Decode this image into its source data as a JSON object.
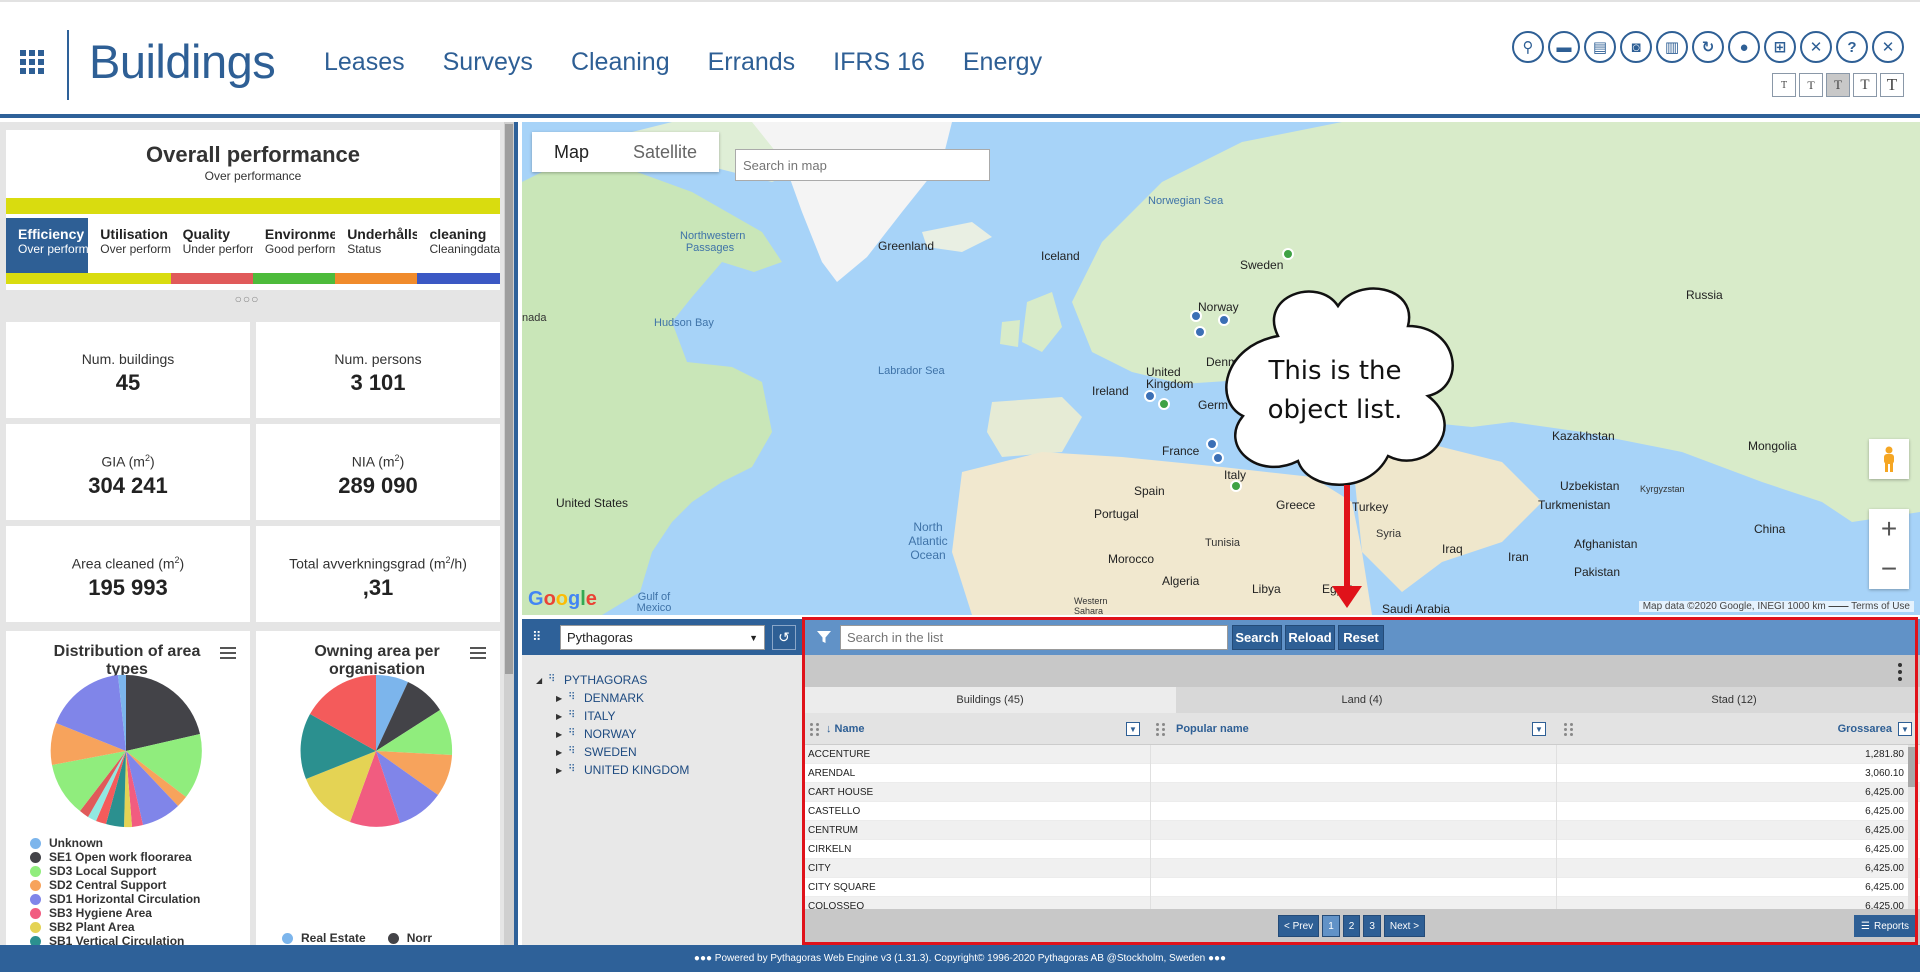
{
  "header": {
    "title": "Buildings",
    "nav": [
      "Leases",
      "Surveys",
      "Cleaning",
      "Errands",
      "IFRS 16",
      "Energy"
    ],
    "text_sizes": [
      "T",
      "T",
      "T",
      "T",
      "T"
    ]
  },
  "performance": {
    "title": "Overall performance",
    "subtitle": "Over performance",
    "dots": "○○○",
    "tabs": [
      {
        "title": "Efficiency",
        "sub": "Over performa",
        "color": "#d9dc0f"
      },
      {
        "title": "Utilisation",
        "sub": "Over performa",
        "color": "#d9dc0f"
      },
      {
        "title": "Quality",
        "sub": "Under perform",
        "color": "#e05a5a"
      },
      {
        "title": "Environme",
        "sub": "Good perform",
        "color": "#4dbb3b"
      },
      {
        "title": "Underhålls",
        "sub": "Status",
        "color": "#f08b2c"
      },
      {
        "title": "cleaning",
        "sub": "Cleaningdata",
        "color": "#3b58c4"
      }
    ]
  },
  "kpis": [
    {
      "label": "Num. buildings",
      "value": "45"
    },
    {
      "label": "Num. persons",
      "value": "3 101"
    },
    {
      "label_pre": "GIA (m",
      "label_sup": "2",
      "label_post": ")",
      "value": "304 241"
    },
    {
      "label_pre": "NIA (m",
      "label_sup": "2",
      "label_post": ")",
      "value": "289 090"
    },
    {
      "label_pre": "Area cleaned (m",
      "label_sup": "2",
      "label_post": ")",
      "value": "195 993"
    },
    {
      "label_pre": "Total avverkningsgrad (m",
      "label_sup": "2",
      "label_post": "/h)",
      "value": ",31"
    }
  ],
  "pies": {
    "area_types": {
      "title": "Distribution of area types",
      "legend": [
        {
          "name": "Unknown",
          "color": "#7cb5ec"
        },
        {
          "name": "SE1 Open work floorarea",
          "color": "#434348"
        },
        {
          "name": "SD3 Local Support",
          "color": "#90ed7d"
        },
        {
          "name": "SD2 Central Support",
          "color": "#f7a35c"
        },
        {
          "name": "SD1 Horizontal Circulation",
          "color": "#8085e9"
        },
        {
          "name": "SB3 Hygiene Area",
          "color": "#f15c80"
        },
        {
          "name": "SB2 Plant Area",
          "color": "#e4d354"
        },
        {
          "name": "SB1 Vertical Circulation",
          "color": "#2b908f"
        }
      ]
    },
    "organisation": {
      "title": "Owning area per organisation",
      "legend": [
        {
          "name": "Real Estate",
          "color": "#7cb5ec"
        },
        {
          "name": "Norr",
          "color": "#434348"
        }
      ]
    }
  },
  "map": {
    "tabs": [
      "Map",
      "Satellite"
    ],
    "search_placeholder": "Search in map",
    "labels": {
      "greenland": "Greenland",
      "iceland": "Iceland",
      "norwegian_sea": "Norwegian Sea",
      "sweden": "Sweden",
      "norway": "Norway",
      "russia": "Russia",
      "united_kingdom": "United Kingdom",
      "ireland": "Ireland",
      "france": "France",
      "spain": "Spain",
      "portugal": "Portugal",
      "italy": "Italy",
      "greece": "Greece",
      "turkey": "Turkey",
      "kazakhstan": "Kazakhstan",
      "mongolia": "Mongolia",
      "uzbekistan": "Uzbekistan",
      "turkmenistan": "Turkmenistan",
      "kyrgyzstan": "Kyrgyzstan",
      "afghanistan": "Afghanistan",
      "pakistan": "Pakistan",
      "iran": "Iran",
      "iraq": "Iraq",
      "syria": "Syria",
      "china": "China",
      "saudi_arabia": "Saudi Arabia",
      "egypt": "Egypt",
      "libya": "Libya",
      "algeria": "Algeria",
      "tunisia": "Tunisia",
      "morocco": "Morocco",
      "western_sahara": "Western Sahara",
      "united_states": "United States",
      "north_atlantic": "North Atlantic Ocean",
      "labrador_sea": "Labrador Sea",
      "hudson_bay": "Hudson Bay",
      "northwestern_passages": "Northwestern Passages",
      "gulf_of_mexico": "Gulf of Mexico",
      "nada": "nada",
      "denm": "Denm",
      "germ": "Germ"
    },
    "credit": "Map data ©2020 Google, INEGI   1000 km ⎯⎯⎯⎯   Terms of Use",
    "google": "Google"
  },
  "callout": {
    "text": "This is the object list."
  },
  "tree": {
    "selected": "Pythagoras",
    "root": "PYTHAGORAS",
    "children": [
      "DENMARK",
      "ITALY",
      "NORWAY",
      "SWEDEN",
      "UNITED KINGDOM"
    ]
  },
  "list": {
    "search_placeholder": "Search in the list",
    "buttons": {
      "search": "Search",
      "reload": "Reload",
      "reset": "Reset"
    },
    "tabs": [
      "Buildings (45)",
      "Land (4)",
      "Stad (12)"
    ],
    "columns": {
      "name": "↓ Name",
      "popular": "Popular name",
      "gross": "Grossarea"
    },
    "rows": [
      {
        "name": "ACCENTURE",
        "area": "1,281.80"
      },
      {
        "name": "ARENDAL",
        "area": "3,060.10"
      },
      {
        "name": "CART HOUSE",
        "area": "6,425.00"
      },
      {
        "name": "CASTELLO",
        "area": "6,425.00"
      },
      {
        "name": "CENTRUM",
        "area": "6,425.00"
      },
      {
        "name": "CIRKELN",
        "area": "6,425.00"
      },
      {
        "name": "CITY",
        "area": "6,425.00"
      },
      {
        "name": "CITY SQUARE",
        "area": "6,425.00"
      },
      {
        "name": "COLOSSEO",
        "area": "6,425.00"
      }
    ],
    "pager": {
      "prev": "< Prev",
      "pages": [
        "1",
        "2",
        "3"
      ],
      "next": "Next >"
    },
    "reports": "Reports"
  },
  "footer": {
    "text": "●●●  Powered by Pythagoras Web Engine v3 (1.31.3). Copyright© 1996-2020 Pythagoras AB @Stockholm, Sweden  ●●●"
  }
}
